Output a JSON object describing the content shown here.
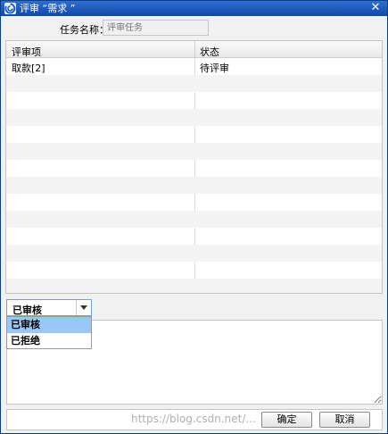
{
  "window": {
    "title": "评审 “需求 ”",
    "close_glyph": "✕"
  },
  "task": {
    "label": "任务名称：",
    "placeholder": "评审任务"
  },
  "grid": {
    "columns": [
      "评审项",
      "状态"
    ],
    "rows": [
      {
        "item": "取款[2]",
        "status": "待评审"
      }
    ]
  },
  "review_select": {
    "value": "已审核",
    "options": [
      "已审核",
      "已拒绝"
    ],
    "selected_option": "已审核"
  },
  "buttons": {
    "ok": "确定",
    "cancel": "取消"
  },
  "watermark": "https://blog.csdn.net/..."
}
